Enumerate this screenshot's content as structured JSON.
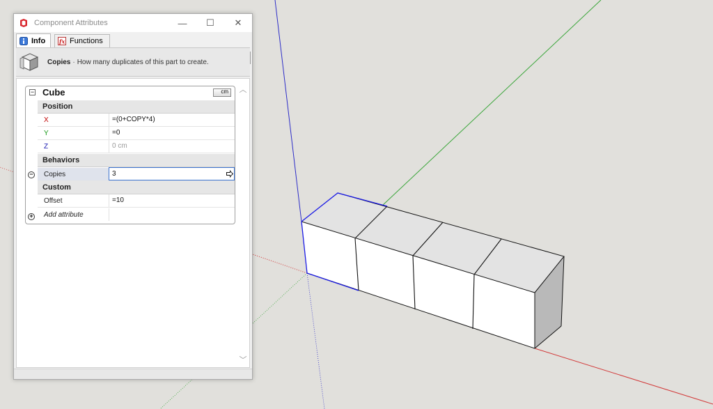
{
  "window": {
    "title": "Component Attributes",
    "minimize_glyph": "—",
    "maximize_glyph": "☐",
    "close_glyph": "✕"
  },
  "tabs": [
    {
      "label": "Info",
      "icon": "info-icon",
      "active": true
    },
    {
      "label": "Functions",
      "icon": "fx-icon",
      "active": false
    }
  ],
  "toolbar": {
    "refresh_icon": "refresh-icon",
    "toggle_formula_icon": "fx-toggle-icon"
  },
  "info": {
    "title": "Copies",
    "separator": "·",
    "description": "How many duplicates of this part to create."
  },
  "component": {
    "name": "Cube",
    "units": "cm",
    "sections": [
      {
        "label": "Position",
        "attributes": [
          {
            "label": "X",
            "value": "=(0+COPY*4)",
            "label_color": "#c00000",
            "value_color": "#111111"
          },
          {
            "label": "Y",
            "value": "=0",
            "label_color": "#1a9a1a",
            "value_color": "#111111"
          },
          {
            "label": "Z",
            "value": "0 cm",
            "label_color": "#1a1ab0",
            "value_color": "#9a9a9a"
          }
        ]
      },
      {
        "label": "Behaviors",
        "attributes": [
          {
            "label": "Copies",
            "value": "3",
            "editing": true
          }
        ]
      },
      {
        "label": "Custom",
        "attributes": [
          {
            "label": "Offset",
            "value": "=10"
          }
        ]
      }
    ],
    "add_attribute_label": "Add attribute"
  },
  "colors": {
    "axis_red": "#d23a3a",
    "axis_green": "#3aa63a",
    "axis_blue": "#2c2cc8",
    "selection_blue": "#1a1ae6",
    "face_light": "#e3e3e3",
    "face_front": "#ffffff",
    "face_end": "#b9b9b9"
  }
}
